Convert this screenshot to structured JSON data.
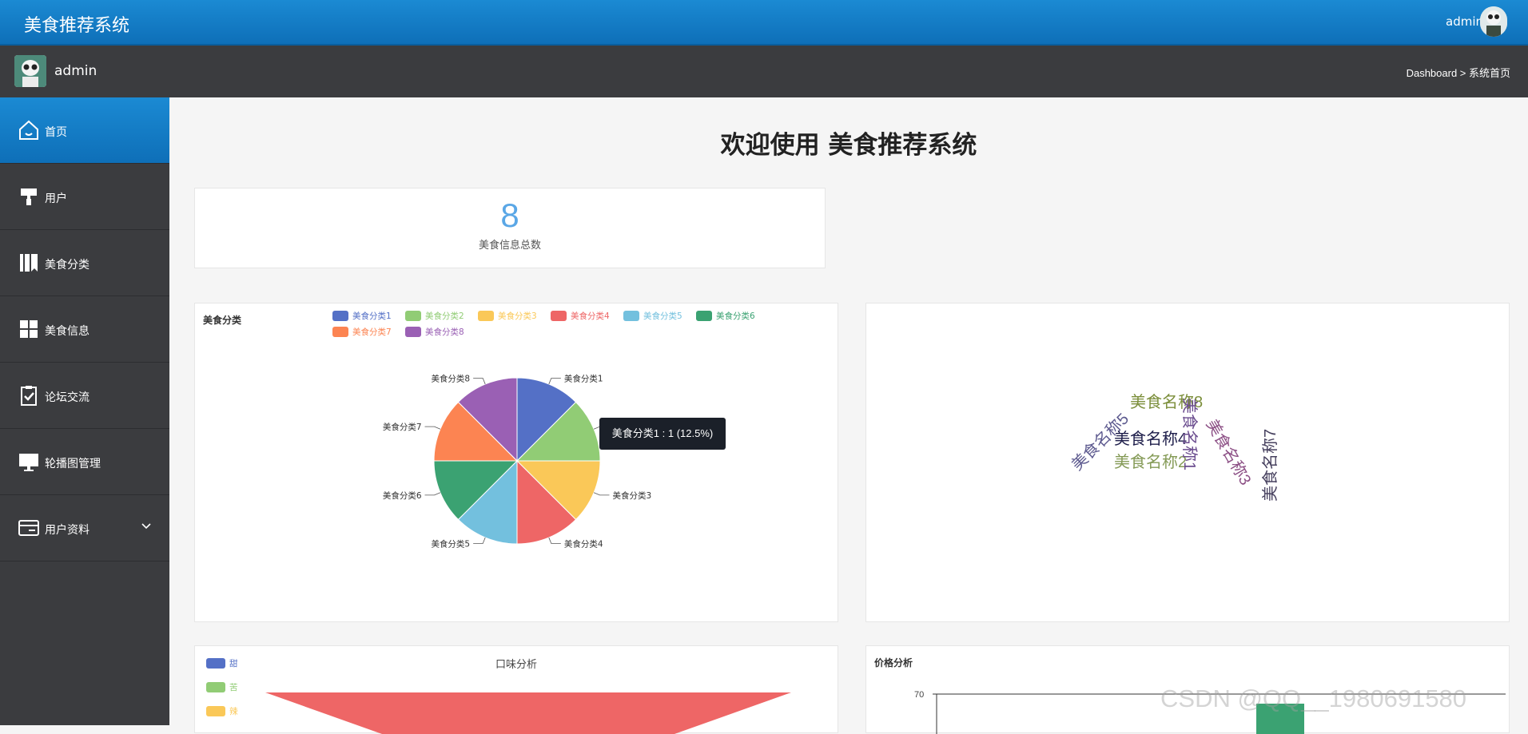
{
  "header": {
    "app_title": "美食推荐系统",
    "user": "admin"
  },
  "subheader": {
    "user": "admin",
    "breadcrumb": "Dashboard > 系统首页"
  },
  "sidebar": {
    "items": [
      {
        "label": "首页",
        "icon": "home-icon",
        "active": true
      },
      {
        "label": "用户",
        "icon": "paint-roller-icon"
      },
      {
        "label": "美食分类",
        "icon": "books-icon"
      },
      {
        "label": "美食信息",
        "icon": "grid-icon"
      },
      {
        "label": "论坛交流",
        "icon": "clipboard-check-icon"
      },
      {
        "label": "轮播图管理",
        "icon": "monitor-icon"
      },
      {
        "label": "用户资料",
        "icon": "card-icon",
        "expandable": true
      }
    ]
  },
  "main": {
    "welcome": "欢迎使用 美食推荐系统",
    "stat": {
      "value": "8",
      "label": "美食信息总数"
    },
    "wordcloud": {
      "words": [
        "美食名称8",
        "美食名称5",
        "美食名称4",
        "美食名称2",
        "美食名称1",
        "美食名称3",
        "美食名称7"
      ]
    },
    "tooltip": "美食分类1 : 1 (12.5%)",
    "taste": {
      "title": "口味分析",
      "legend": [
        "甜",
        "苦",
        "辣"
      ]
    },
    "price": {
      "title": "价格分析",
      "ytick": "70"
    }
  },
  "chart_data": [
    {
      "type": "pie",
      "title": "美食分类",
      "categories": [
        "美食分类1",
        "美食分类2",
        "美食分类3",
        "美食分类4",
        "美食分类5",
        "美食分类6",
        "美食分类7",
        "美食分类8"
      ],
      "values": [
        1,
        1,
        1,
        1,
        1,
        1,
        1,
        1
      ],
      "colors": [
        "#5470c6",
        "#91cc75",
        "#fac858",
        "#ee6666",
        "#73c0de",
        "#3ba272",
        "#fc8452",
        "#9a60b4"
      ],
      "legend": "top"
    },
    {
      "type": "funnel",
      "title": "口味分析",
      "categories": [
        "甜",
        "苦",
        "辣"
      ],
      "colors": [
        "#5470c6",
        "#91cc75",
        "#fac858"
      ]
    },
    {
      "type": "bar",
      "title": "价格分析",
      "yticks": [
        70
      ]
    }
  ],
  "watermark": "CSDN @QQ__1980691580"
}
